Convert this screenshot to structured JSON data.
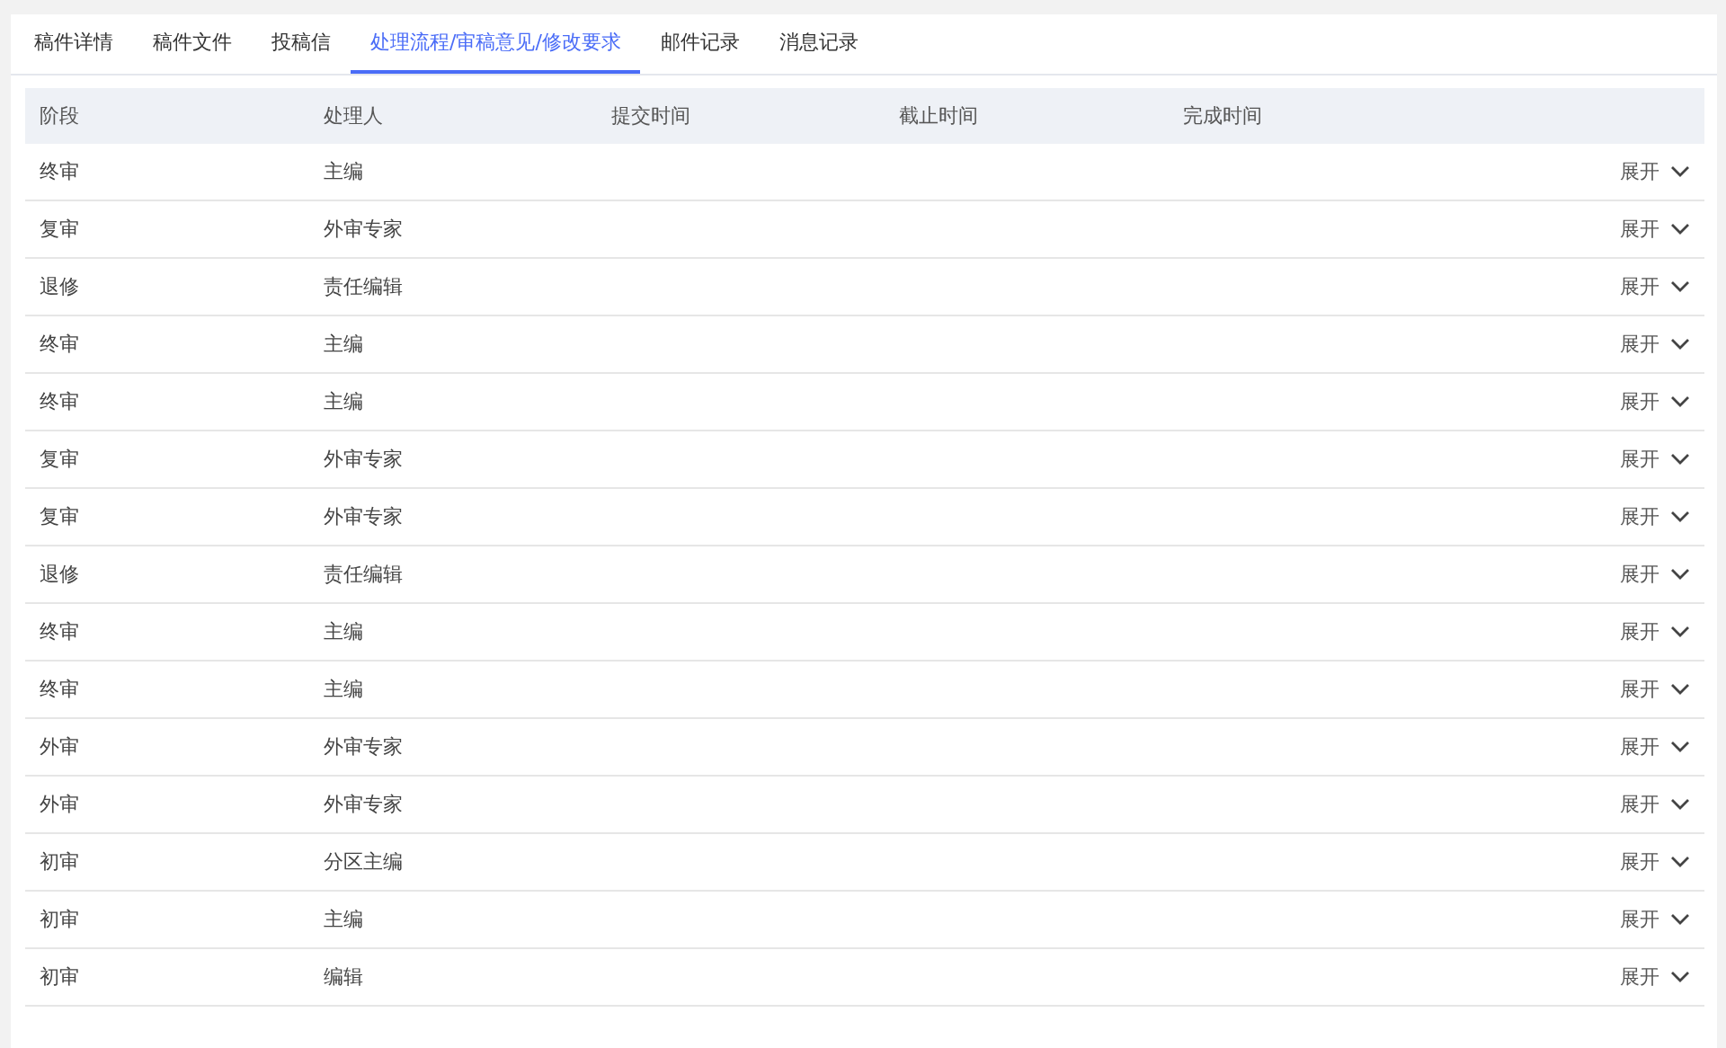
{
  "tabs": [
    {
      "label": "稿件详情",
      "selected": false
    },
    {
      "label": "稿件文件",
      "selected": false
    },
    {
      "label": "投稿信",
      "selected": false
    },
    {
      "label": "处理流程/审稿意见/修改要求",
      "selected": true
    },
    {
      "label": "邮件记录",
      "selected": false
    },
    {
      "label": "消息记录",
      "selected": false
    }
  ],
  "table": {
    "columns": [
      "阶段",
      "处理人",
      "提交时间",
      "截止时间",
      "完成时间"
    ],
    "rows": [
      {
        "stage": "终审",
        "handler": "主编",
        "toggle": "展开"
      },
      {
        "stage": "复审",
        "handler": "外审专家",
        "toggle": "展开"
      },
      {
        "stage": "退修",
        "handler": "责任编辑",
        "toggle": "展开"
      },
      {
        "stage": "终审",
        "handler": "主编",
        "toggle": "展开"
      },
      {
        "stage": "终审",
        "handler": "主编",
        "toggle": "展开"
      },
      {
        "stage": "复审",
        "handler": "外审专家",
        "toggle": "展开"
      },
      {
        "stage": "复审",
        "handler": "外审专家",
        "toggle": "展开"
      },
      {
        "stage": "退修",
        "handler": "责任编辑",
        "toggle": "展开"
      },
      {
        "stage": "终审",
        "handler": "主编",
        "toggle": "展开"
      },
      {
        "stage": "终审",
        "handler": "主编",
        "toggle": "展开"
      },
      {
        "stage": "外审",
        "handler": "外审专家",
        "toggle": "展开"
      },
      {
        "stage": "外审",
        "handler": "外审专家",
        "toggle": "展开"
      },
      {
        "stage": "初审",
        "handler": "分区主编",
        "toggle": "展开"
      },
      {
        "stage": "初审",
        "handler": "主编",
        "toggle": "展开"
      },
      {
        "stage": "初审",
        "handler": "编辑",
        "toggle": "展开"
      }
    ]
  }
}
